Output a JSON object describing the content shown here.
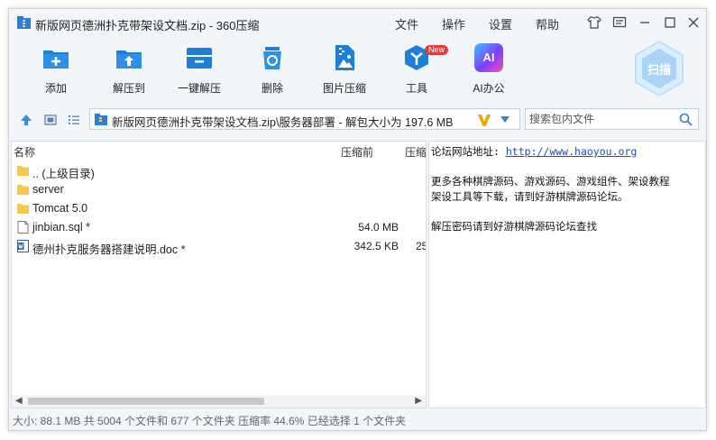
{
  "window": {
    "title": "新版网页德洲扑克带架设文档.zip - 360压缩",
    "menu": [
      "文件",
      "操作",
      "设置",
      "帮助"
    ]
  },
  "toolbar": {
    "tools": [
      {
        "label": "添加",
        "icon": "add-icon"
      },
      {
        "label": "解压到",
        "icon": "extract-to-icon"
      },
      {
        "label": "一键解压",
        "icon": "one-click-extract-icon"
      },
      {
        "label": "删除",
        "icon": "delete-icon"
      },
      {
        "label": "图片压缩",
        "icon": "image-compress-icon"
      },
      {
        "label": "工具",
        "icon": "tools-icon"
      },
      {
        "label": "AI办公",
        "icon": "ai-office-icon"
      }
    ],
    "new_badge": "New",
    "ai_icon_text": "AI",
    "scan_label": "扫描"
  },
  "address": {
    "path": "新版网页德洲扑克带架设文档.zip\\服务器部署 - 解包大小为 197.6 MB"
  },
  "search": {
    "placeholder": "搜索包内文件"
  },
  "files": {
    "columns": {
      "name": "名称",
      "compressed_before": "压缩前",
      "compressed_after": "压缩"
    },
    "rows": [
      {
        "name": ".. (上级目录)",
        "type": "folder",
        "size": "",
        "extra": ""
      },
      {
        "name": "server",
        "type": "folder",
        "size": "",
        "extra": ""
      },
      {
        "name": "Tomcat 5.0",
        "type": "folder",
        "size": "",
        "extra": ""
      },
      {
        "name": "jinbian.sql *",
        "type": "file",
        "size": "54.0 MB",
        "extra": ""
      },
      {
        "name": "德州扑克服务器搭建说明.doc *",
        "type": "doc",
        "size": "342.5 KB",
        "extra": "25"
      }
    ]
  },
  "comment": {
    "site_label": "论坛网站地址:",
    "site_url": "http://www.haoyou.org",
    "line2": "更多各种棋牌源码、游戏源码、游戏组件、架设教程",
    "line3": "架设工具等下载，请到好游棋牌源码论坛。",
    "line4": "解压密码请到好游棋牌源码论坛查找"
  },
  "status": {
    "text": "大小: 88.1 MB 共 5004 个文件和 677 个文件夹 压缩率 44.6% 已经选择 1 个文件夹"
  },
  "colors": {
    "accent": "#1e7fd8",
    "window_bg": "#f2f6fb",
    "folder": "#f7c948",
    "badge": "#e23b3b",
    "link": "#1a4fb5"
  }
}
